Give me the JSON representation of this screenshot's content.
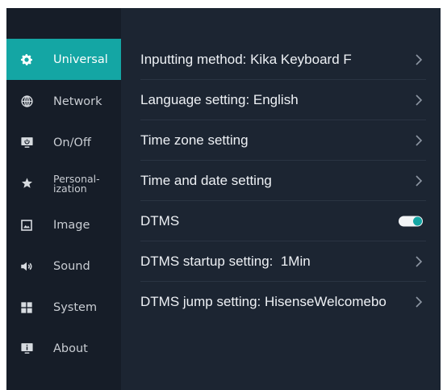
{
  "sidebar": {
    "items": [
      {
        "label": "Universal",
        "icon": "gear-icon",
        "active": true
      },
      {
        "label": "Network",
        "icon": "globe-icon"
      },
      {
        "label": "On/Off",
        "icon": "power-monitor-icon"
      },
      {
        "label_line1": "Personal-",
        "label_line2": "ization",
        "icon": "star-icon"
      },
      {
        "label": "Image",
        "icon": "image-icon"
      },
      {
        "label": "Sound",
        "icon": "speaker-icon"
      },
      {
        "label": "System",
        "icon": "system-grid-icon"
      },
      {
        "label": "About",
        "icon": "info-monitor-icon"
      }
    ]
  },
  "settings": {
    "rows": [
      {
        "label": "Inputting method: Kika Keyboard F"
      },
      {
        "label": "Language setting: English"
      },
      {
        "label": "Time zone setting"
      },
      {
        "label": "Time and date setting"
      },
      {
        "label": "DTMS",
        "toggle_on": true
      },
      {
        "label": "DTMS startup setting:  1Min"
      },
      {
        "label": "DTMS jump setting: HisenseWelcomebo"
      }
    ]
  },
  "colors": {
    "accent": "#14a6a4",
    "sidebar_bg": "#161d28",
    "content_bg": "#1c2532",
    "text": "#eef1f5"
  }
}
